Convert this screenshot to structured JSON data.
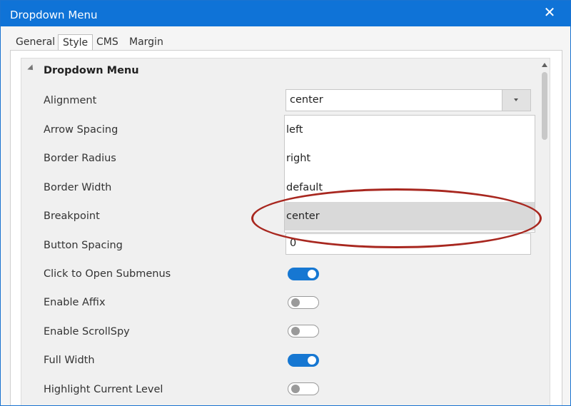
{
  "window": {
    "title": "Dropdown Menu",
    "close_glyph": "✕"
  },
  "tabs": [
    {
      "label": "General"
    },
    {
      "label": "Style"
    },
    {
      "label": "CMS"
    },
    {
      "label": "Margin"
    }
  ],
  "section": {
    "title": "Dropdown Menu"
  },
  "rows": [
    {
      "label": "Alignment",
      "control": "select",
      "value": "center"
    },
    {
      "label": "Arrow Spacing"
    },
    {
      "label": "Border Radius"
    },
    {
      "label": "Border Width"
    },
    {
      "label": "Breakpoint"
    },
    {
      "label": "Button Spacing",
      "control": "input",
      "value": "0"
    },
    {
      "label": "Click to Open Submenus",
      "control": "toggle",
      "on": true
    },
    {
      "label": "Enable Affix",
      "control": "toggle",
      "on": false
    },
    {
      "label": "Enable ScrollSpy",
      "control": "toggle",
      "on": false
    },
    {
      "label": "Full Width",
      "control": "toggle",
      "on": true
    },
    {
      "label": "Highlight Current Level",
      "control": "toggle",
      "on": false
    }
  ],
  "alignment_dropdown": {
    "options": [
      "left",
      "right",
      "default",
      "center"
    ],
    "selected": "center"
  },
  "colors": {
    "titlebar": "#0f73d7",
    "toggle_on": "#1677d2",
    "annotation": "#a8271f"
  },
  "icons": {
    "close": "close-icon",
    "collapse": "collapse-triangle-icon",
    "dropdown": "chevron-down-icon",
    "scroll_up": "scroll-up-arrow-icon"
  }
}
